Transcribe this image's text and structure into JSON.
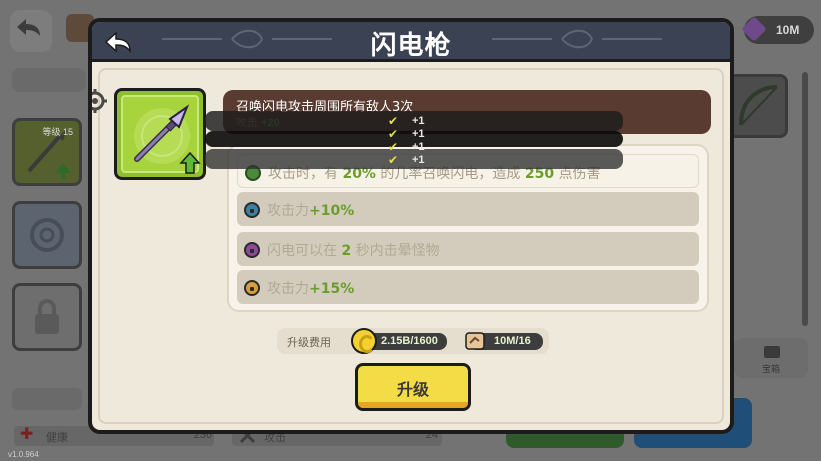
{
  "background": {
    "gem_amount": "10M",
    "weapon_level_label": "等级 15",
    "version": "v1.0.964",
    "stat_left_label": "健康",
    "stat_left_value": "236",
    "stat_right_label": "攻击",
    "stat_right_value": "24",
    "right_button_label": "宝箱"
  },
  "dialog": {
    "title": "闪电枪",
    "description": "召唤闪电攻击周围所有敌人3次",
    "sub_label": "攻击",
    "sub_value": "+20",
    "popup_plus": [
      "+1",
      "+1",
      "+1",
      "+1"
    ],
    "skills": [
      {
        "pre": "攻击时，有",
        "hl1": "20%",
        "mid": "的几率召唤闪电，造成",
        "hl2": "250",
        "post": "点伤害",
        "state": "unlocked",
        "color": "#4a8a3a"
      },
      {
        "pre": "攻击力",
        "hl1": "+10%",
        "mid": "",
        "hl2": "",
        "post": "",
        "state": "locked",
        "color": "#3f7fa0"
      },
      {
        "pre": "闪电可以在",
        "hl1": "2",
        "mid": "秒内击晕怪物",
        "hl2": "",
        "post": "",
        "state": "locked",
        "color": "#8a4a9a"
      },
      {
        "pre": "攻击力",
        "hl1": "+15%",
        "mid": "",
        "hl2": "",
        "post": "",
        "state": "locked",
        "color": "#d3a03a"
      }
    ],
    "cost_label": "升级费用",
    "coin_cost": "2.15B/1600",
    "scroll_cost": "10M/16",
    "upgrade_label": "升级"
  },
  "colors": {
    "header": "#3b4253",
    "panel": "#efe9dc",
    "item_card": "#a7d33d",
    "upgrade_button": "#f3dc45",
    "highlight": "#6a9d2e"
  },
  "icons": [
    "back-arrow-icon",
    "gear-icon",
    "spear-icon",
    "upgrade-arrow-icon",
    "lock-icon",
    "coin-icon",
    "scroll-icon",
    "gem-icon",
    "bow-icon"
  ]
}
